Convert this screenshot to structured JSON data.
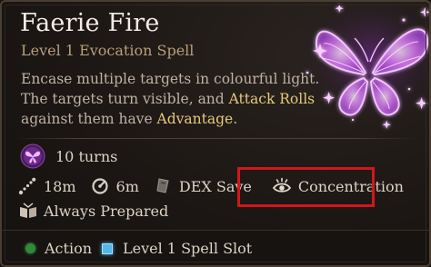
{
  "spell": {
    "name": "Faerie Fire",
    "level_school": "Level 1 Evocation Spell",
    "description": {
      "line1": "Encase multiple targets in colourful light.",
      "line2_pre": "The targets turn visible, and ",
      "line2_kw": "Attack Rolls",
      "line3_pre": "against them have ",
      "line3_kw": "Advantage",
      "line3_post": "."
    }
  },
  "duration": {
    "value": "10 turns",
    "icon": "butterfly-icon"
  },
  "properties": {
    "range": "18m",
    "aoe": "6m",
    "save": "DEX Save",
    "concentration": "Concentration",
    "prepared": "Always Prepared"
  },
  "costs": {
    "action": "Action",
    "spell_slot": "Level 1 Spell Slot"
  },
  "colors": {
    "accent_keyword": "#e7c97a",
    "highlight_box": "#d4161b",
    "butterfly_glow": "#d25bff",
    "action_dot": "#2f8a3a",
    "spell_slot": "#55b6e8"
  }
}
